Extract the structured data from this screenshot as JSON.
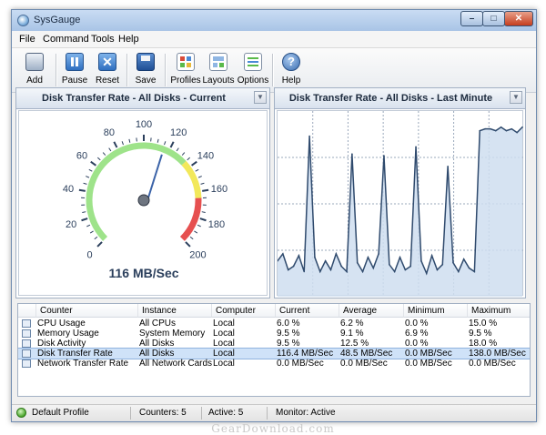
{
  "window": {
    "title": "SysGauge"
  },
  "menu": [
    "File",
    "Command",
    "Tools",
    "Help"
  ],
  "toolbar": [
    {
      "label": "Add",
      "icon": "computer-icon"
    },
    {
      "label": "Pause",
      "icon": "pause-icon"
    },
    {
      "label": "Reset",
      "icon": "reset-icon"
    },
    {
      "label": "Save",
      "icon": "save-icon"
    },
    {
      "label": "Profiles",
      "icon": "profiles-icon"
    },
    {
      "label": "Layouts",
      "icon": "layouts-icon"
    },
    {
      "label": "Options",
      "icon": "options-icon"
    },
    {
      "label": "Help",
      "icon": "help-icon"
    }
  ],
  "gauge_panel": {
    "title": "Disk Transfer Rate - All Disks - Current",
    "readout": "116 MB/Sec",
    "ticks": [
      "0",
      "20",
      "40",
      "60",
      "80",
      "100",
      "120",
      "140",
      "160",
      "180",
      "200"
    ]
  },
  "graph_panel": {
    "title": "Disk Transfer Rate - All Disks - Last Minute"
  },
  "chart_data": [
    {
      "type": "gauge",
      "value": 116,
      "min": 0,
      "max": 200,
      "unit": "MB/Sec",
      "bands": [
        {
          "from": 0,
          "to": 135,
          "color": "#9ee38a"
        },
        {
          "from": 135,
          "to": 165,
          "color": "#f2e85a"
        },
        {
          "from": 165,
          "to": 200,
          "color": "#e65050"
        }
      ]
    },
    {
      "type": "area",
      "ylim": [
        0,
        1
      ],
      "grid": true,
      "values": [
        0.18,
        0.22,
        0.13,
        0.15,
        0.21,
        0.12,
        0.88,
        0.2,
        0.12,
        0.18,
        0.13,
        0.22,
        0.15,
        0.12,
        0.78,
        0.17,
        0.12,
        0.2,
        0.14,
        0.22,
        0.77,
        0.16,
        0.12,
        0.2,
        0.13,
        0.15,
        0.82,
        0.18,
        0.11,
        0.21,
        0.13,
        0.16,
        0.71,
        0.17,
        0.12,
        0.19,
        0.14,
        0.12,
        0.91,
        0.92,
        0.92,
        0.91,
        0.93,
        0.91,
        0.92,
        0.9,
        0.93
      ]
    }
  ],
  "table": {
    "columns": [
      "Counter",
      "Instance",
      "Computer",
      "Current",
      "Average",
      "Minimum",
      "Maximum"
    ],
    "rows": [
      {
        "counter": "CPU Usage",
        "instance": "All CPUs",
        "computer": "Local",
        "current": "6.0 %",
        "average": "6.2 %",
        "minimum": "0.0 %",
        "maximum": "15.0 %"
      },
      {
        "counter": "Memory Usage",
        "instance": "System Memory",
        "computer": "Local",
        "current": "9.5 %",
        "average": "9.1 %",
        "minimum": "6.9 %",
        "maximum": "9.5 %"
      },
      {
        "counter": "Disk Activity",
        "instance": "All Disks",
        "computer": "Local",
        "current": "9.5 %",
        "average": "12.5 %",
        "minimum": "0.0 %",
        "maximum": "18.0 %"
      },
      {
        "counter": "Disk Transfer Rate",
        "instance": "All Disks",
        "computer": "Local",
        "current": "116.4 MB/Sec",
        "average": "48.5 MB/Sec",
        "minimum": "0.0 MB/Sec",
        "maximum": "138.0 MB/Sec"
      },
      {
        "counter": "Network Transfer Rate",
        "instance": "All Network Cards",
        "computer": "Local",
        "current": "0.0 MB/Sec",
        "average": "0.0 MB/Sec",
        "minimum": "0.0 MB/Sec",
        "maximum": "0.0 MB/Sec"
      }
    ],
    "selected_index": 3
  },
  "status": {
    "profile": "Default Profile",
    "counters": "Counters: 5",
    "active": "Active: 5",
    "monitor": "Monitor: Active"
  },
  "watermark": "GearDownload.com",
  "colors": {
    "accent": "#2f4a6d",
    "selection": "#cfe2f8",
    "area_fill": "#cfdef0"
  }
}
